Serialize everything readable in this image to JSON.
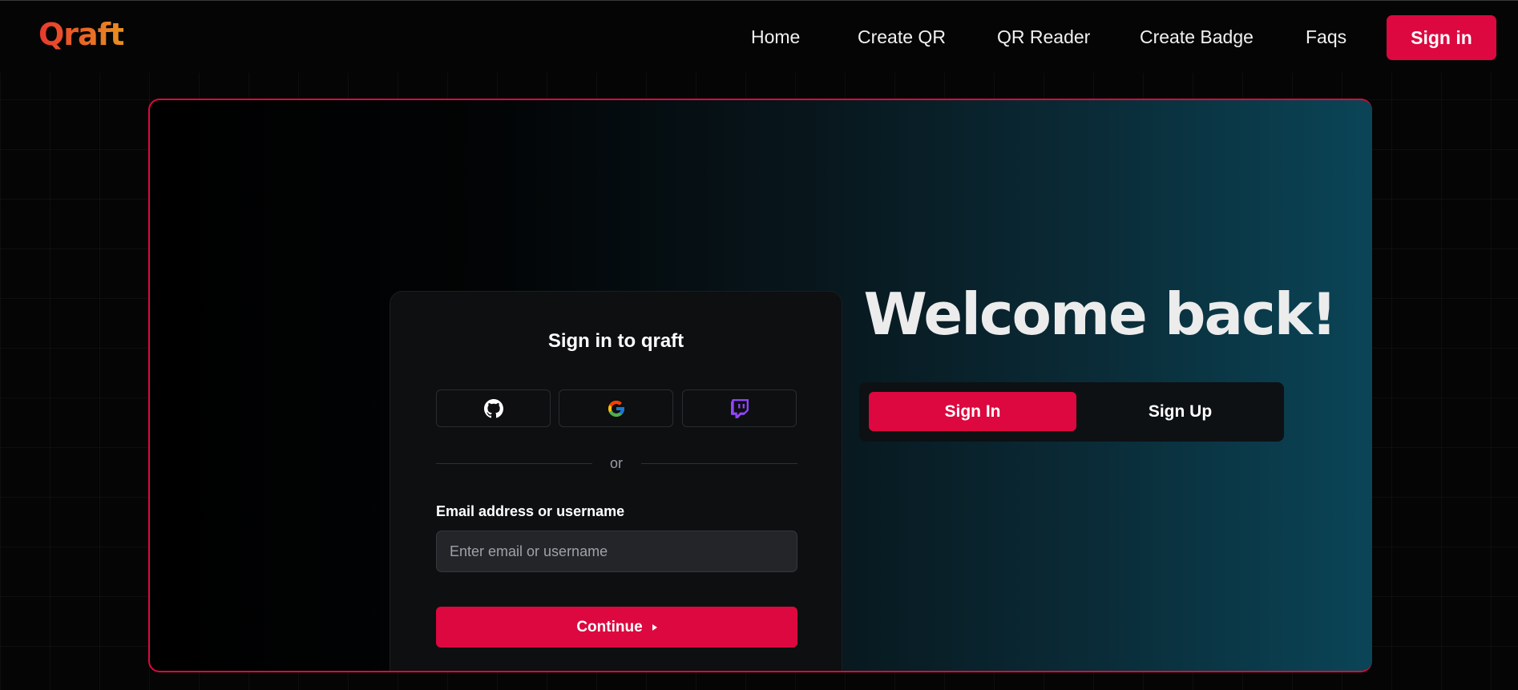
{
  "header": {
    "logo": "Qraft",
    "nav": [
      "Home",
      "Create QR",
      "QR Reader",
      "Create Badge",
      "Faqs"
    ],
    "signin_label": "Sign in"
  },
  "signin_card": {
    "title": "Sign in to qraft",
    "providers": [
      {
        "icon": "github-icon"
      },
      {
        "icon": "google-icon"
      },
      {
        "icon": "twitch-icon"
      }
    ],
    "divider_text": "or",
    "email_label": "Email address or username",
    "email_value": "",
    "email_placeholder": "Enter email or username",
    "continue_label": "Continue"
  },
  "hero": {
    "welcome": "Welcome back!",
    "toggle": {
      "active": "Sign In",
      "inactive": "Sign Up"
    }
  },
  "colors": {
    "accent": "#dc083f",
    "logo_gradient": [
      "#e8382f",
      "#e8901f"
    ],
    "panel_gradient_end": "#0a4557"
  }
}
